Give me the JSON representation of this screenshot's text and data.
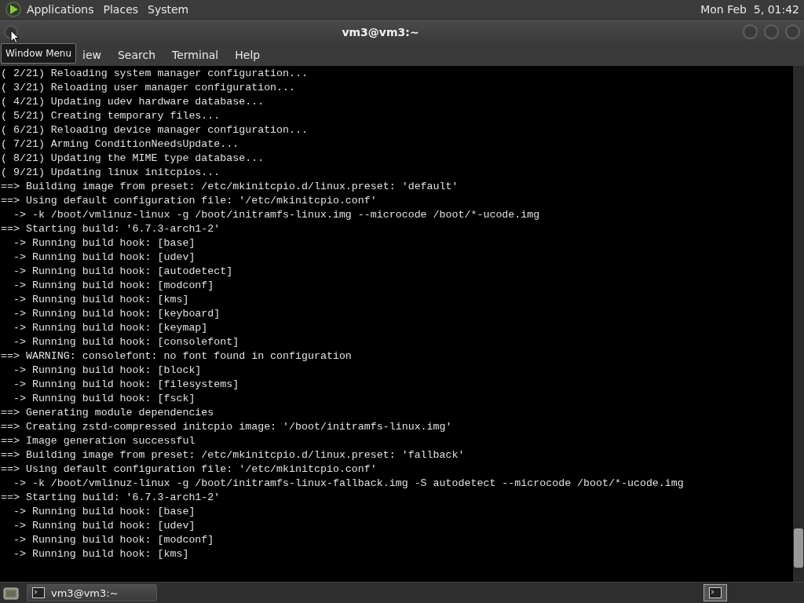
{
  "top_panel": {
    "menus": [
      "Applications",
      "Places",
      "System"
    ],
    "clock": "Mon Feb  5, 01:42"
  },
  "window": {
    "title": "vm3@vm3:~",
    "tooltip": "Window Menu",
    "menu": [
      "iew",
      "Search",
      "Terminal",
      "Help"
    ]
  },
  "terminal": {
    "lines": [
      "( 2/21) Reloading system manager configuration...",
      "( 3/21) Reloading user manager configuration...",
      "( 4/21) Updating udev hardware database...",
      "( 5/21) Creating temporary files...",
      "( 6/21) Reloading device manager configuration...",
      "( 7/21) Arming ConditionNeedsUpdate...",
      "( 8/21) Updating the MIME type database...",
      "( 9/21) Updating linux initcpios...",
      "==> Building image from preset: /etc/mkinitcpio.d/linux.preset: 'default'",
      "==> Using default configuration file: '/etc/mkinitcpio.conf'",
      "  -> -k /boot/vmlinuz-linux -g /boot/initramfs-linux.img --microcode /boot/*-ucode.img",
      "==> Starting build: '6.7.3-arch1-2'",
      "  -> Running build hook: [base]",
      "  -> Running build hook: [udev]",
      "  -> Running build hook: [autodetect]",
      "  -> Running build hook: [modconf]",
      "  -> Running build hook: [kms]",
      "  -> Running build hook: [keyboard]",
      "  -> Running build hook: [keymap]",
      "  -> Running build hook: [consolefont]",
      "==> WARNING: consolefont: no font found in configuration",
      "  -> Running build hook: [block]",
      "  -> Running build hook: [filesystems]",
      "  -> Running build hook: [fsck]",
      "==> Generating module dependencies",
      "==> Creating zstd-compressed initcpio image: '/boot/initramfs-linux.img'",
      "==> Image generation successful",
      "==> Building image from preset: /etc/mkinitcpio.d/linux.preset: 'fallback'",
      "==> Using default configuration file: '/etc/mkinitcpio.conf'",
      "  -> -k /boot/vmlinuz-linux -g /boot/initramfs-linux-fallback.img -S autodetect --microcode /boot/*-ucode.img",
      "==> Starting build: '6.7.3-arch1-2'",
      "  -> Running build hook: [base]",
      "  -> Running build hook: [udev]",
      "  -> Running build hook: [modconf]",
      "  -> Running build hook: [kms]"
    ]
  },
  "taskbar": {
    "tasks": [
      "vm3@vm3:~"
    ]
  }
}
